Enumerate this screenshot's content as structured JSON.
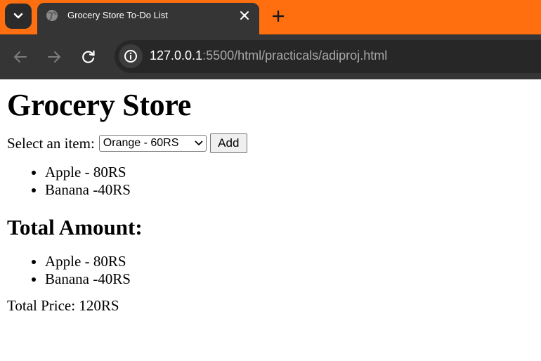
{
  "browser": {
    "tab_title": "Grocery Store To-Do List",
    "url_host": "127.0.0.1",
    "url_rest": ":5500/html/practicals/adiproj.html",
    "accent_color": "#ff6f0f"
  },
  "page": {
    "heading": "Grocery Store",
    "select_label": "Select an item:",
    "selected_item": "Orange - 60RS",
    "add_button": "Add",
    "items": [
      "Apple - 80RS",
      "Banana -40RS"
    ],
    "total_heading": "Total Amount:",
    "total_items": [
      "Apple - 80RS",
      "Banana -40RS"
    ],
    "total_price": "Total Price: 120RS"
  },
  "icons": [
    "tab-search-chevron-icon",
    "globe-icon",
    "close-icon",
    "plus-icon",
    "back-arrow-icon",
    "forward-arrow-icon",
    "reload-icon",
    "site-info-icon"
  ]
}
